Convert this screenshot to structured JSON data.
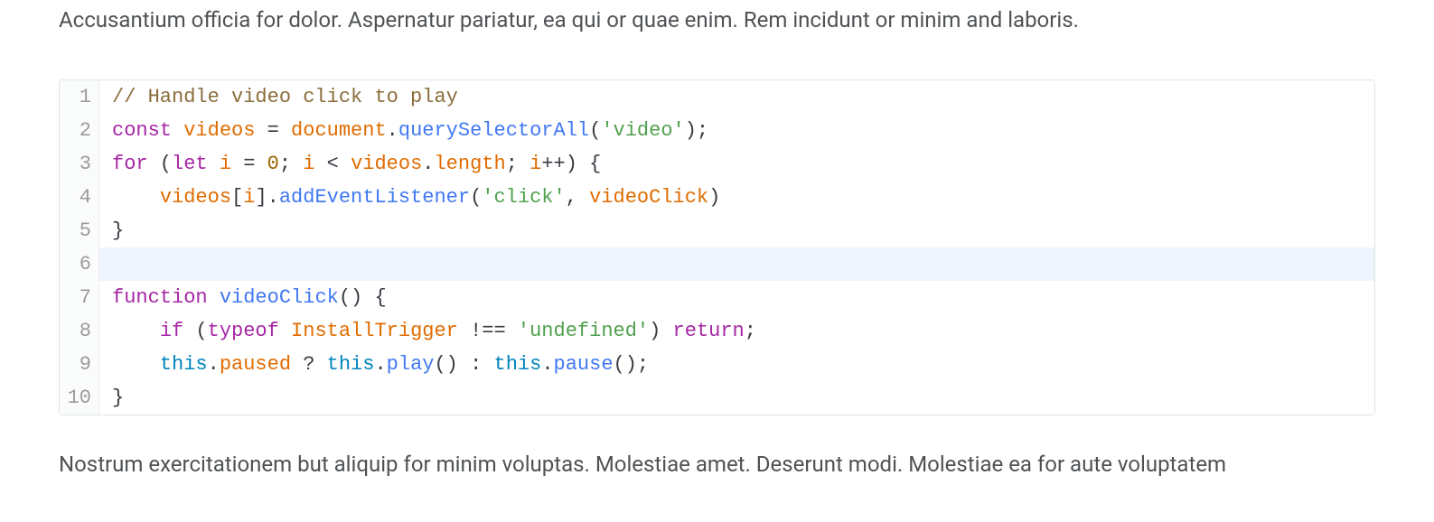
{
  "paragraph_top": "Accusantium officia for dolor. Aspernatur pariatur, ea qui or quae enim. Rem incidunt or minim and laboris.",
  "paragraph_bottom": "Nostrum exercitationem but aliquip for minim voluptas. Molestiae amet. Deserunt modi. Molestiae ea for aute voluptatem",
  "code": {
    "highlight_line": 6,
    "lines": [
      {
        "n": "1",
        "tokens": [
          {
            "c": "tok-comment",
            "t": "// Handle video click to play"
          }
        ]
      },
      {
        "n": "2",
        "tokens": [
          {
            "c": "tok-kw",
            "t": "const"
          },
          {
            "c": "tok-plain",
            "t": " "
          },
          {
            "c": "tok-ident",
            "t": "videos"
          },
          {
            "c": "tok-plain",
            "t": " = "
          },
          {
            "c": "tok-ident",
            "t": "document"
          },
          {
            "c": "tok-plain",
            "t": "."
          },
          {
            "c": "tok-func",
            "t": "querySelectorAll"
          },
          {
            "c": "tok-plain",
            "t": "("
          },
          {
            "c": "tok-string",
            "t": "'video'"
          },
          {
            "c": "tok-plain",
            "t": ");"
          }
        ]
      },
      {
        "n": "3",
        "tokens": [
          {
            "c": "tok-kw",
            "t": "for"
          },
          {
            "c": "tok-plain",
            "t": " ("
          },
          {
            "c": "tok-kw",
            "t": "let"
          },
          {
            "c": "tok-plain",
            "t": " "
          },
          {
            "c": "tok-ident",
            "t": "i"
          },
          {
            "c": "tok-plain",
            "t": " = "
          },
          {
            "c": "tok-number",
            "t": "0"
          },
          {
            "c": "tok-plain",
            "t": "; "
          },
          {
            "c": "tok-ident",
            "t": "i"
          },
          {
            "c": "tok-plain",
            "t": " < "
          },
          {
            "c": "tok-ident",
            "t": "videos"
          },
          {
            "c": "tok-plain",
            "t": "."
          },
          {
            "c": "tok-ident",
            "t": "length"
          },
          {
            "c": "tok-plain",
            "t": "; "
          },
          {
            "c": "tok-ident",
            "t": "i"
          },
          {
            "c": "tok-plain",
            "t": "++) {"
          }
        ]
      },
      {
        "n": "4",
        "tokens": [
          {
            "c": "tok-plain",
            "t": "    "
          },
          {
            "c": "tok-ident",
            "t": "videos"
          },
          {
            "c": "tok-plain",
            "t": "["
          },
          {
            "c": "tok-ident",
            "t": "i"
          },
          {
            "c": "tok-plain",
            "t": "]."
          },
          {
            "c": "tok-func",
            "t": "addEventListener"
          },
          {
            "c": "tok-plain",
            "t": "("
          },
          {
            "c": "tok-string",
            "t": "'click'"
          },
          {
            "c": "tok-plain",
            "t": ", "
          },
          {
            "c": "tok-ident",
            "t": "videoClick"
          },
          {
            "c": "tok-plain",
            "t": ")"
          }
        ]
      },
      {
        "n": "5",
        "tokens": [
          {
            "c": "tok-plain",
            "t": "}"
          }
        ]
      },
      {
        "n": "6",
        "tokens": [
          {
            "c": "tok-plain",
            "t": ""
          }
        ]
      },
      {
        "n": "7",
        "tokens": [
          {
            "c": "tok-kw",
            "t": "function"
          },
          {
            "c": "tok-plain",
            "t": " "
          },
          {
            "c": "tok-func",
            "t": "videoClick"
          },
          {
            "c": "tok-plain",
            "t": "() {"
          }
        ]
      },
      {
        "n": "8",
        "tokens": [
          {
            "c": "tok-plain",
            "t": "    "
          },
          {
            "c": "tok-kw",
            "t": "if"
          },
          {
            "c": "tok-plain",
            "t": " ("
          },
          {
            "c": "tok-kw2",
            "t": "typeof"
          },
          {
            "c": "tok-plain",
            "t": " "
          },
          {
            "c": "tok-ident",
            "t": "InstallTrigger"
          },
          {
            "c": "tok-plain",
            "t": " !== "
          },
          {
            "c": "tok-string",
            "t": "'undefined'"
          },
          {
            "c": "tok-plain",
            "t": ") "
          },
          {
            "c": "tok-kw2",
            "t": "return"
          },
          {
            "c": "tok-plain",
            "t": ";"
          }
        ]
      },
      {
        "n": "9",
        "tokens": [
          {
            "c": "tok-plain",
            "t": "    "
          },
          {
            "c": "tok-this",
            "t": "this"
          },
          {
            "c": "tok-plain",
            "t": "."
          },
          {
            "c": "tok-ident",
            "t": "paused"
          },
          {
            "c": "tok-plain",
            "t": " ? "
          },
          {
            "c": "tok-this",
            "t": "this"
          },
          {
            "c": "tok-plain",
            "t": "."
          },
          {
            "c": "tok-func",
            "t": "play"
          },
          {
            "c": "tok-plain",
            "t": "() : "
          },
          {
            "c": "tok-this",
            "t": "this"
          },
          {
            "c": "tok-plain",
            "t": "."
          },
          {
            "c": "tok-func",
            "t": "pause"
          },
          {
            "c": "tok-plain",
            "t": "();"
          }
        ]
      },
      {
        "n": "10",
        "tokens": [
          {
            "c": "tok-plain",
            "t": "}"
          }
        ]
      }
    ]
  }
}
